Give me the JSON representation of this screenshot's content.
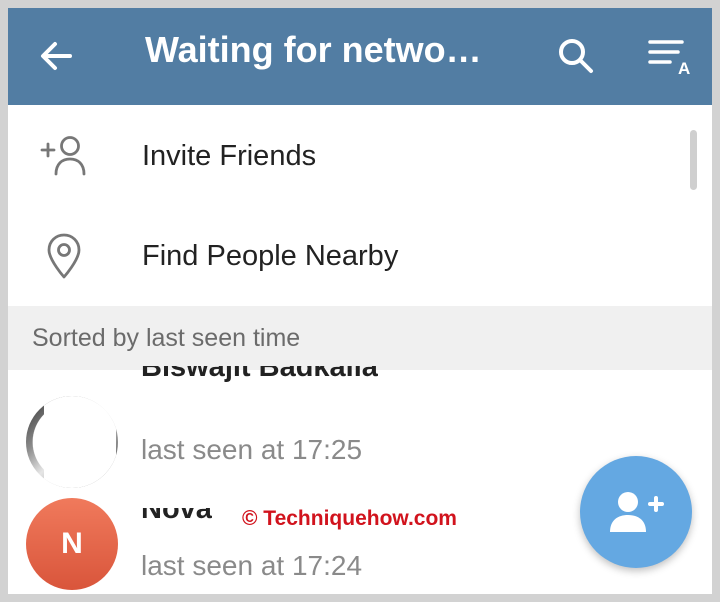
{
  "header": {
    "title": "Waiting for netwo…",
    "back_icon": "arrow-left-icon",
    "search_icon": "search-icon",
    "sort_icon": "sort-alphabet-icon",
    "color": "#527da3"
  },
  "menu": [
    {
      "label": "Invite Friends",
      "icon": "add-person-icon"
    },
    {
      "label": "Find People Nearby",
      "icon": "location-pin-icon"
    }
  ],
  "section": {
    "title": "Sorted by last seen time"
  },
  "contacts": [
    {
      "name": "Biswajit Badkalia",
      "status": "last seen at 17:25",
      "avatar": "photo"
    },
    {
      "name": "Nova",
      "status": "last seen at 17:24",
      "avatar_letter": "N",
      "avatar_color": "#e5654a"
    }
  ],
  "fab": {
    "icon": "add-contact-icon",
    "color": "#64a8e2"
  },
  "watermark": "© Techniquehow.com"
}
